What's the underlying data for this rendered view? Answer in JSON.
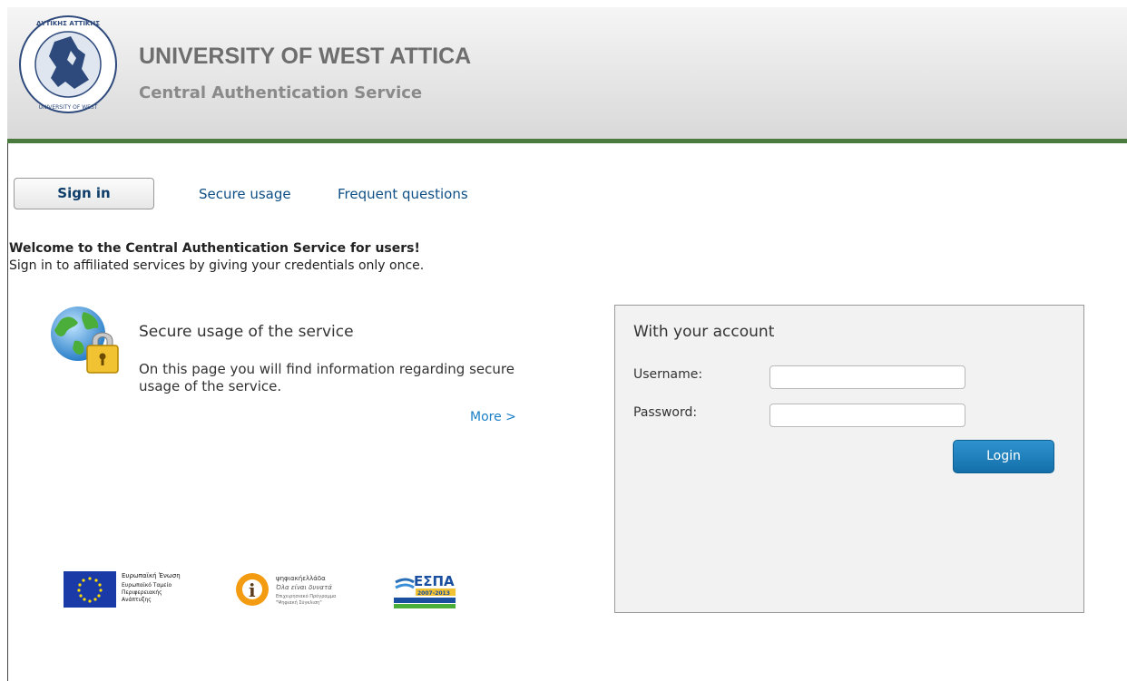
{
  "header": {
    "title": "UNIVERSITY OF WEST ATTICA",
    "subtitle": "Central Authentication Service",
    "logo_text": "ΠΑΝΕΠΙΣΤΗΜΙΟ ΔΥΤΙΚΗΣ ΑΤΤΙΚΗΣ · UNIVERSITY OF WEST ATTICA"
  },
  "tabs": {
    "signin": "Sign in",
    "secure_usage": "Secure usage",
    "faq": "Frequent questions"
  },
  "welcome": {
    "line1": "Welcome to the Central Authentication Service for users!",
    "line2": "Sign in to affiliated services by giving your credentials only once."
  },
  "secure_section": {
    "title": "Secure usage of the service",
    "text": "On this page you will find information regarding secure usage of the service.",
    "more": "More >"
  },
  "login": {
    "title": "With your account",
    "username_label": "Username:",
    "username_value": "",
    "password_label": "Password:",
    "password_value": "",
    "button": "Login"
  },
  "sponsors": {
    "eu_text": "Ευρωπαϊκή Ένωση · Ευρωπαϊκό Ταμείο Περιφερειακής Ανάπτυξης",
    "digital_text": "ψηφιακήελλάδα · Όλα είναι δυνατά · Επιχειρησιακό Πρόγραμμα \"Ψηφιακή Σύγκλιση\"",
    "espa_text": "ΕΣΠΑ 2007-2013"
  },
  "colors": {
    "header_border": "#4a7a3e",
    "link": "#0e4f86",
    "button": "#1a7fc6"
  }
}
